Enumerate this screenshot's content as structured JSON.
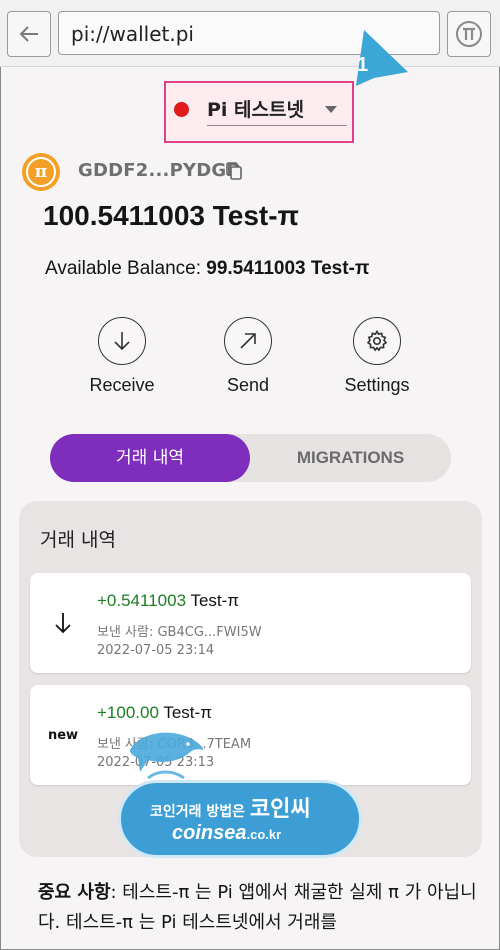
{
  "browser": {
    "url": "pi://wallet.pi",
    "back_icon": "back-arrow-icon",
    "pi_browser_icon": "pi-browser-icon"
  },
  "tutorial": {
    "step_number": "1",
    "color": "#3aa7d6"
  },
  "network": {
    "label": "Pi 테스트넷",
    "status_color": "#e11a1a",
    "highlight_color": "#e0408a"
  },
  "account": {
    "address": "GDDF2...PYDGD",
    "balance": "100.5411003 Test-π",
    "available_label": "Available Balance:",
    "available_value": "99.5411003 Test-π"
  },
  "actions": [
    {
      "label": "Receive",
      "icon": "arrow-down-icon"
    },
    {
      "label": "Send",
      "icon": "arrow-up-right-icon"
    },
    {
      "label": "Settings",
      "icon": "gear-icon"
    }
  ],
  "tabs": [
    {
      "label": "거래 내역",
      "active": true
    },
    {
      "label": "MIGRATIONS",
      "active": false
    }
  ],
  "accent_color": "#7f2dbd",
  "history": {
    "title": "거래 내역",
    "items": [
      {
        "badge": "",
        "amount_sign": "+0.5411003",
        "unit": " Test-π",
        "from": "보낸 사람: GB4CG...FWI5W",
        "date": "2022-07-05 23:14"
      },
      {
        "badge": "new",
        "amount_sign": "+100.00",
        "unit": " Test-π",
        "from": "보낸 사람: COR3...7TEAM",
        "date": "2022-07-05 23:13"
      }
    ]
  },
  "watermark": {
    "line1_small": "코인거래 방법은",
    "line1_big": "코인씨",
    "line2_main": "coinsea",
    "line2_suffix": ".co.kr"
  },
  "notice": {
    "bold": "중요 사항",
    "text": ": 테스트-π 는 Pi 앱에서 채굴한 실제 π 가 아닙니다. 테스트-π 는 Pi 테스트넷에서 거래를"
  }
}
